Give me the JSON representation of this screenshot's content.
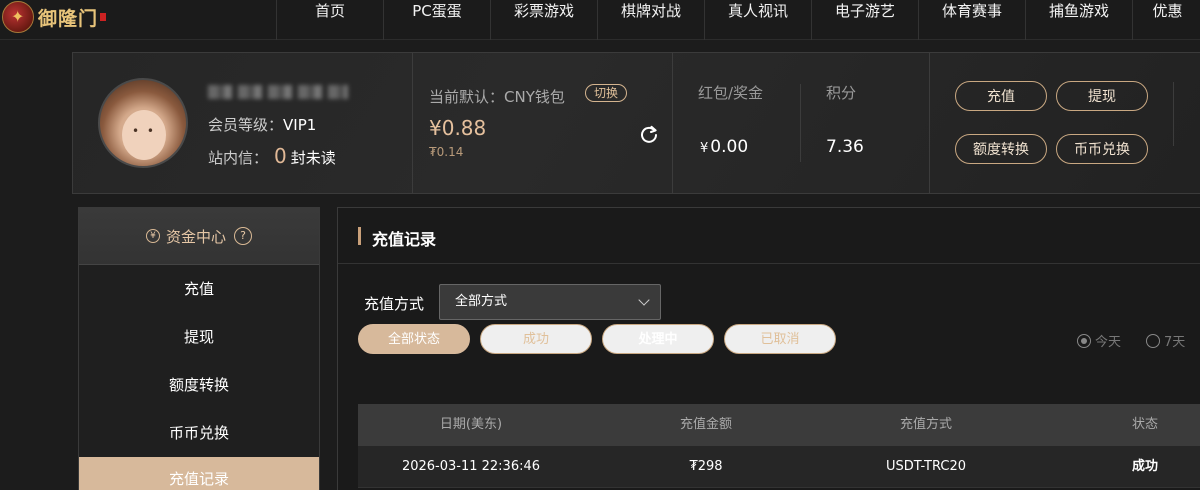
{
  "brand": {
    "logo_text": "御隆门"
  },
  "nav": {
    "items": [
      {
        "label": "首页",
        "width": 107
      },
      {
        "label": "PC蛋蛋",
        "width": 107
      },
      {
        "label": "彩票游戏",
        "width": 107
      },
      {
        "label": "棋牌对战",
        "width": 107
      },
      {
        "label": "真人视讯",
        "width": 107
      },
      {
        "label": "电子游艺",
        "width": 107
      },
      {
        "label": "体育赛事",
        "width": 107
      },
      {
        "label": "捕鱼游戏",
        "width": 107
      },
      {
        "label": "优惠",
        "width": 70
      }
    ]
  },
  "user": {
    "level_label": "会员等级：",
    "level_value": "VIP1",
    "inbox_label": "站内信：",
    "inbox_count": "0",
    "inbox_suffix": "封未读"
  },
  "wallet": {
    "default_label": "当前默认：CNY钱包",
    "switch_label": "切换",
    "balance": "¥0.88",
    "balance_sub": "₮0.14"
  },
  "stats": {
    "bonus_label": "红包/奖金",
    "bonus_currency": "¥",
    "bonus_value": "0.00",
    "points_label": "积分",
    "points_value": "7.36"
  },
  "actions": {
    "deposit": "充值",
    "withdraw": "提现",
    "transfer": "额度转换",
    "coin_exchange": "币币兑换"
  },
  "sidebar": {
    "header": "资金中心",
    "items": [
      {
        "label": "充值",
        "active": false
      },
      {
        "label": "提现",
        "active": false
      },
      {
        "label": "额度转换",
        "active": false
      },
      {
        "label": "币币兑换",
        "active": false
      },
      {
        "label": "充值记录",
        "active": true
      }
    ]
  },
  "main": {
    "title": "充值记录",
    "filter_label": "充值方式",
    "select_value": "全部方式",
    "status_filters": [
      "全部状态",
      "成功",
      "处理中",
      "已取消"
    ],
    "range_options": [
      "今天",
      "7天"
    ],
    "table": {
      "headers": [
        "日期(美东)",
        "充值金额",
        "充值方式",
        "状态"
      ],
      "rows": [
        [
          "2026-03-11 22:36:46",
          "₮298",
          "USDT-TRC20",
          "成功"
        ]
      ]
    }
  }
}
